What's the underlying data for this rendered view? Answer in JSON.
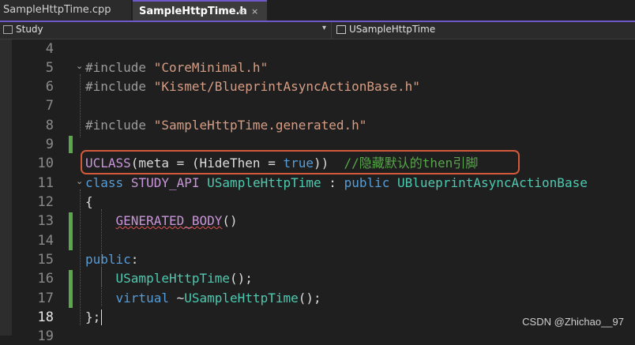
{
  "tabs": [
    {
      "label": "SampleHttpTime.cpp",
      "active": false
    },
    {
      "label": "SampleHttpTime.h",
      "active": true,
      "pin_glyph": "⊕",
      "close_glyph": "×"
    }
  ],
  "navbar": {
    "project": "Study",
    "project_icon": "project-icon",
    "dropdown_glyph": "▾",
    "class_name": "USampleHttpTime",
    "class_icon": "class-icon"
  },
  "editor": {
    "line_numbers": [
      "4",
      "5",
      "6",
      "7",
      "8",
      "9",
      "10",
      "11",
      "12",
      "13",
      "14",
      "15",
      "16",
      "17",
      "18",
      "19"
    ],
    "current_line": "18",
    "lines": {
      "l5_pp": "#include",
      "l5_str": "\"CoreMinimal.h\"",
      "l6_pp": "#include",
      "l6_str": "\"Kismet/BlueprintAsyncActionBase.h\"",
      "l8_pp": "#include",
      "l8_str": "\"SampleHttpTime.generated.h\"",
      "l10_macro": "UCLASS",
      "l10_a": "(meta = (HideThen = ",
      "l10_kw": "true",
      "l10_b": "))",
      "l10_comment": "//隐藏默认的then引脚",
      "l11_kw1": "class",
      "l11_api": "STUDY_API",
      "l11_type1": "USampleHttpTime",
      "l11_colon": ":",
      "l11_kw2": "public",
      "l11_type2": "UBlueprintAsyncActionBase",
      "l12": "{",
      "l13_macro": "GENERATED_BODY",
      "l13_paren": "()",
      "l15_kw": "public",
      "l15_colon": ":",
      "l16_type": "USampleHttpTime",
      "l16_rest": "();",
      "l17_kw": "virtual",
      "l17_tilde": "~",
      "l17_type": "USampleHttpTime",
      "l17_rest": "();",
      "l18": "};"
    },
    "fold_glyph": "⌄"
  },
  "watermark": "CSDN @Zhichao__97",
  "colors": {
    "accent": "#6f58c9",
    "highlight_border": "#d25a3a",
    "change_marker": "#59a84a"
  }
}
